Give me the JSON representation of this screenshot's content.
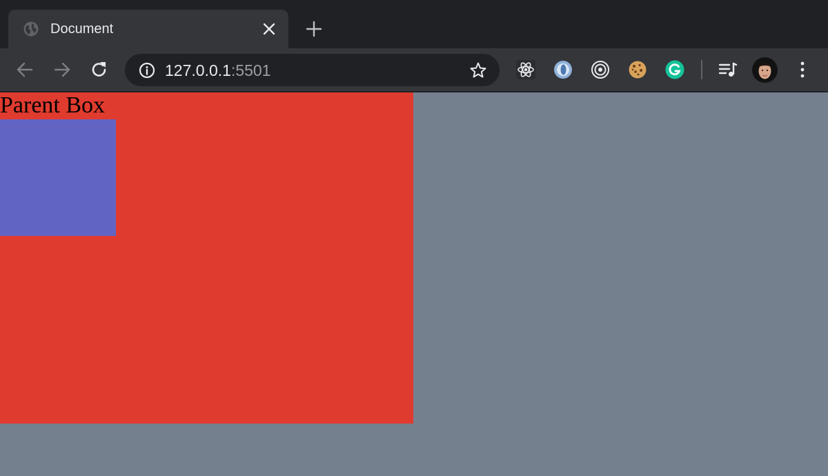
{
  "browser": {
    "tab": {
      "title": "Document",
      "favicon": "globe-icon"
    },
    "address_bar": {
      "host": "127.0.0.1",
      "port": ":5501"
    },
    "extensions": [
      "react-devtools-icon",
      "vue-devtools-icon",
      "target-icon",
      "cookie-icon",
      "grammarly-icon"
    ],
    "colors": {
      "tabstrip": "#202124",
      "toolbar": "#35363a",
      "omnibox": "#202124"
    }
  },
  "page": {
    "background_color": "#75808f",
    "parent_box": {
      "label": "Parent Box",
      "color": "#e03b2f"
    },
    "child_box": {
      "color": "#6264c4"
    }
  }
}
